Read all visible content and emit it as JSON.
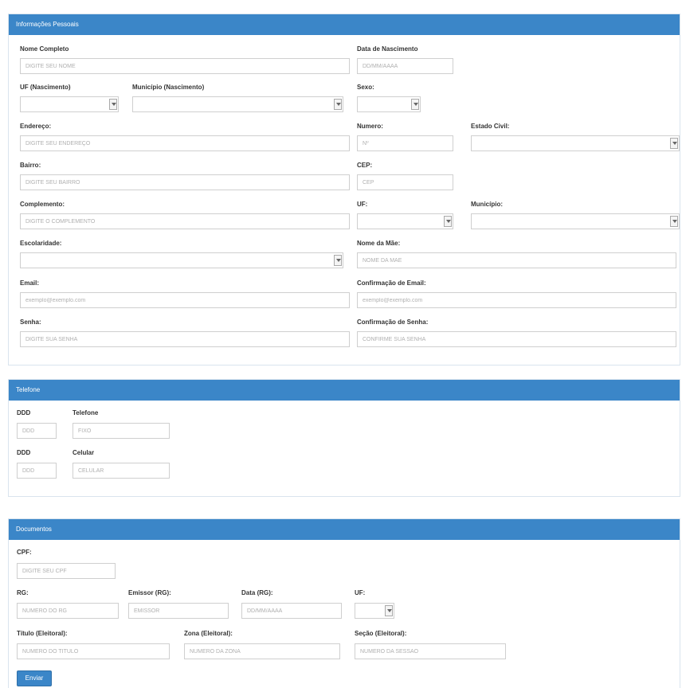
{
  "personal": {
    "title": "Informações Pessoais",
    "nome_label": "Nome Completo",
    "nome_placeholder": "DIGITE SEU NOME",
    "nascimento_label": "Data de Nascimento",
    "nascimento_placeholder": "DD/MM/AAAA",
    "uf_nasc_label": "UF (Nascimento)",
    "municipio_nasc_label": "Município (Nascimento)",
    "sexo_label": "Sexo:",
    "endereco_label": "Endereço:",
    "endereco_placeholder": "DIGITE SEU ENDEREÇO",
    "numero_label": "Numero:",
    "numero_placeholder": "nº",
    "estado_civil_label": "Estado Civil:",
    "bairro_label": "Bairro:",
    "bairro_placeholder": "DIGITE SEU BAIRRO",
    "cep_label": "CEP:",
    "cep_placeholder": "CEP",
    "complemento_label": "Complemento:",
    "complemento_placeholder": "DIGITE O COMPLEMENTO",
    "uf_label": "UF:",
    "municipio_label": "Município:",
    "escolaridade_label": "Escolaridade:",
    "mae_label": "Nome da Mãe:",
    "mae_placeholder": "NOME DA MÃE",
    "email_label": "Email:",
    "email_placeholder": "exemplo@exemplo.com",
    "email_conf_label": "Confirmação de Email:",
    "email_conf_placeholder": "exemplo@exemplo.com",
    "senha_label": "Senha:",
    "senha_placeholder": "DIGITE SUA SENHA",
    "senha_conf_label": "Confirmação de Senha:",
    "senha_conf_placeholder": "CONFIRME SUA SENHA"
  },
  "phones": {
    "title": "Telefone",
    "ddd_label": "DDD",
    "ddd_placeholder": "DDD",
    "telefone_label": "Telefone",
    "telefone_placeholder": "FIXO",
    "ddd2_label": "DDD",
    "ddd2_placeholder": "DDD",
    "celular_label": "Celular",
    "celular_placeholder": "CELULAR"
  },
  "documents": {
    "title": "Documentos",
    "cpf_label": "CPF:",
    "cpf_placeholder": "DIGITE SEU CPF",
    "rg_label": "RG:",
    "rg_placeholder": "NUMERO DO RG",
    "emissor_label": "Emissor (RG):",
    "emissor_placeholder": "EMISSOR",
    "data_rg_label": "Data (RG):",
    "data_rg_placeholder": "DD/MM/AAAA",
    "uf_rg_label": "UF:",
    "titulo_label": "Título (Eleitoral):",
    "titulo_placeholder": "NUMERO DO TITULO",
    "zona_label": "Zona (Eleitoral):",
    "zona_placeholder": "NUMERO DA ZONA",
    "secao_label": "Seção (Eleitoral):",
    "secao_placeholder": "NUMERO DA SESSAO",
    "submit_label": "Enviar"
  },
  "colors": {
    "header": "#3b86c8",
    "border": "#cfcfcf"
  }
}
